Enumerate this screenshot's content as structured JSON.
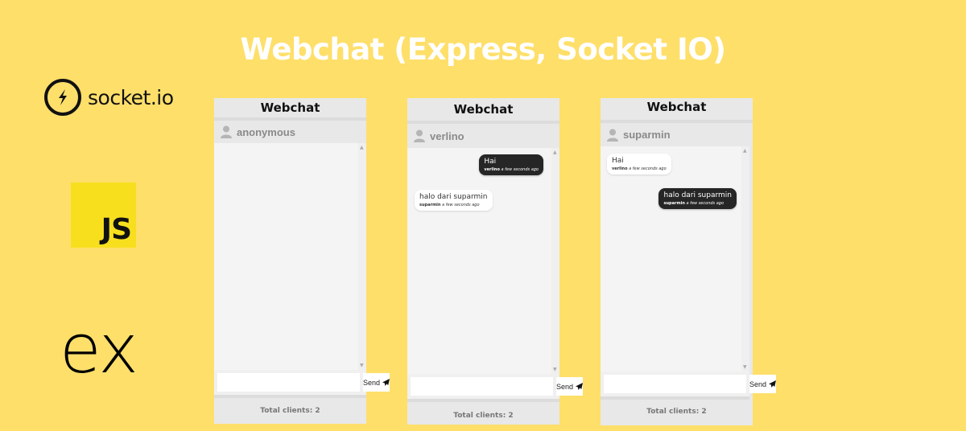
{
  "page_title": "Webchat (Express, Socket IO)",
  "logos": {
    "socketio": "socket.io",
    "js": "JS",
    "express": "ex"
  },
  "panels": [
    {
      "title": "Webchat",
      "username": "anonymous",
      "messages": [],
      "input_value": "",
      "send_label": "Send",
      "footer": "Total clients: 2"
    },
    {
      "title": "Webchat",
      "username": "verlino",
      "messages": [
        {
          "text": "Hai",
          "author": "verlino",
          "time": "a few seconds ago",
          "own": true
        },
        {
          "text": "halo dari suparmin",
          "author": "suparmin",
          "time": "a few seconds ago",
          "own": false
        }
      ],
      "input_value": "",
      "send_label": "Send",
      "footer": "Total clients: 2"
    },
    {
      "title": "Webchat",
      "username": "suparmin",
      "messages": [
        {
          "text": "Hai",
          "author": "verlino",
          "time": "a few seconds ago",
          "own": false
        },
        {
          "text": "halo dari suparmin",
          "author": "suparmin",
          "time": "a few seconds ago",
          "own": true
        }
      ],
      "input_value": "",
      "send_label": "Send",
      "footer": "Total clients: 2"
    }
  ],
  "icons": {
    "user": "user-icon",
    "send": "paper-plane-icon"
  }
}
